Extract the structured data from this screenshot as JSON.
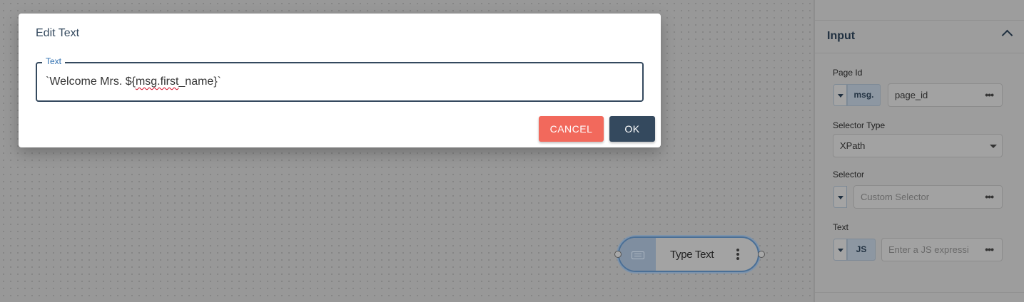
{
  "dialog": {
    "title": "Edit Text",
    "field_label": "Text",
    "value_prefix": "`Welcome Mrs. ${",
    "value_misspelled": "msg.first",
    "value_suffix": "_name}`",
    "cancel_label": "CANCEL",
    "ok_label": "OK"
  },
  "panel": {
    "section_title": "Input",
    "page_id": {
      "label": "Page Id",
      "tag": "msg.",
      "value": "page_id"
    },
    "selector_type": {
      "label": "Selector Type",
      "value": "XPath"
    },
    "selector": {
      "label": "Selector",
      "placeholder": "Custom Selector"
    },
    "text": {
      "label": "Text",
      "tag": "JS",
      "placeholder": "Enter a JS expressi"
    },
    "more_glyph": "•••"
  },
  "node": {
    "label": "Type Text",
    "icon": "keyboard-icon"
  },
  "colors": {
    "primary": "#34495e",
    "cancel": "#f2695c",
    "legend": "#2f6fb0",
    "node_border": "#4a6f96"
  }
}
